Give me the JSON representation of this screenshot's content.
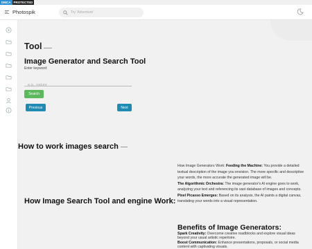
{
  "badge": {
    "dmca": "DMCA",
    "protected": "PROTECTED"
  },
  "header": {
    "app_name": "Photospik",
    "search_placeholder": "Try 'Adventure'"
  },
  "sidebar": {
    "icons": [
      "home-icon",
      "folder-icon",
      "folder-icon",
      "folder-icon",
      "folder-icon",
      "folder-icon",
      "folder-icon",
      "user-icon",
      "info-icon"
    ]
  },
  "tool_section": {
    "title": "Tool",
    "generator_title": "Image Generator and Search Tool",
    "enter_label": "Enter keyword:",
    "keyword_placeholder": "e.g., nature",
    "search_button": "Search",
    "previous_button": "Previous",
    "next_button": "Next"
  },
  "how_section": {
    "title": "How to work images search"
  },
  "engine_section": {
    "title": "How Image Search Tool and engine Work:"
  },
  "explain": {
    "intro": "How Image Generators Work: ",
    "p1_bold": "Feeding the Machine:",
    "p1_text": " You provide a detailed textual description of the image you envision. The more specific and descriptive your words, the more accurate the generated image will be.",
    "p2_bold": "The Algorithmic Orchestra:",
    "p2_text": " The image generator's AI engine goes to work, analyzing your text and referencing its vast database of images and concepts.",
    "p3_bold": "Pixel Picasso Emerges:",
    "p3_text": " Based on its analysis, the AI paints a digital canvas, translating your words into a visual representation."
  },
  "benefits": {
    "title": "Benefits of Image Generators:",
    "b1_bold": "Spark Creativity:",
    "b1_text": " Overcome creative roadblocks and explore visual ideas beyond your usual artistic repertoire.",
    "b2_bold": "Boost Communication:",
    "b2_text": " Enhance presentations, proposals, or social media content with captivating visuals."
  }
}
